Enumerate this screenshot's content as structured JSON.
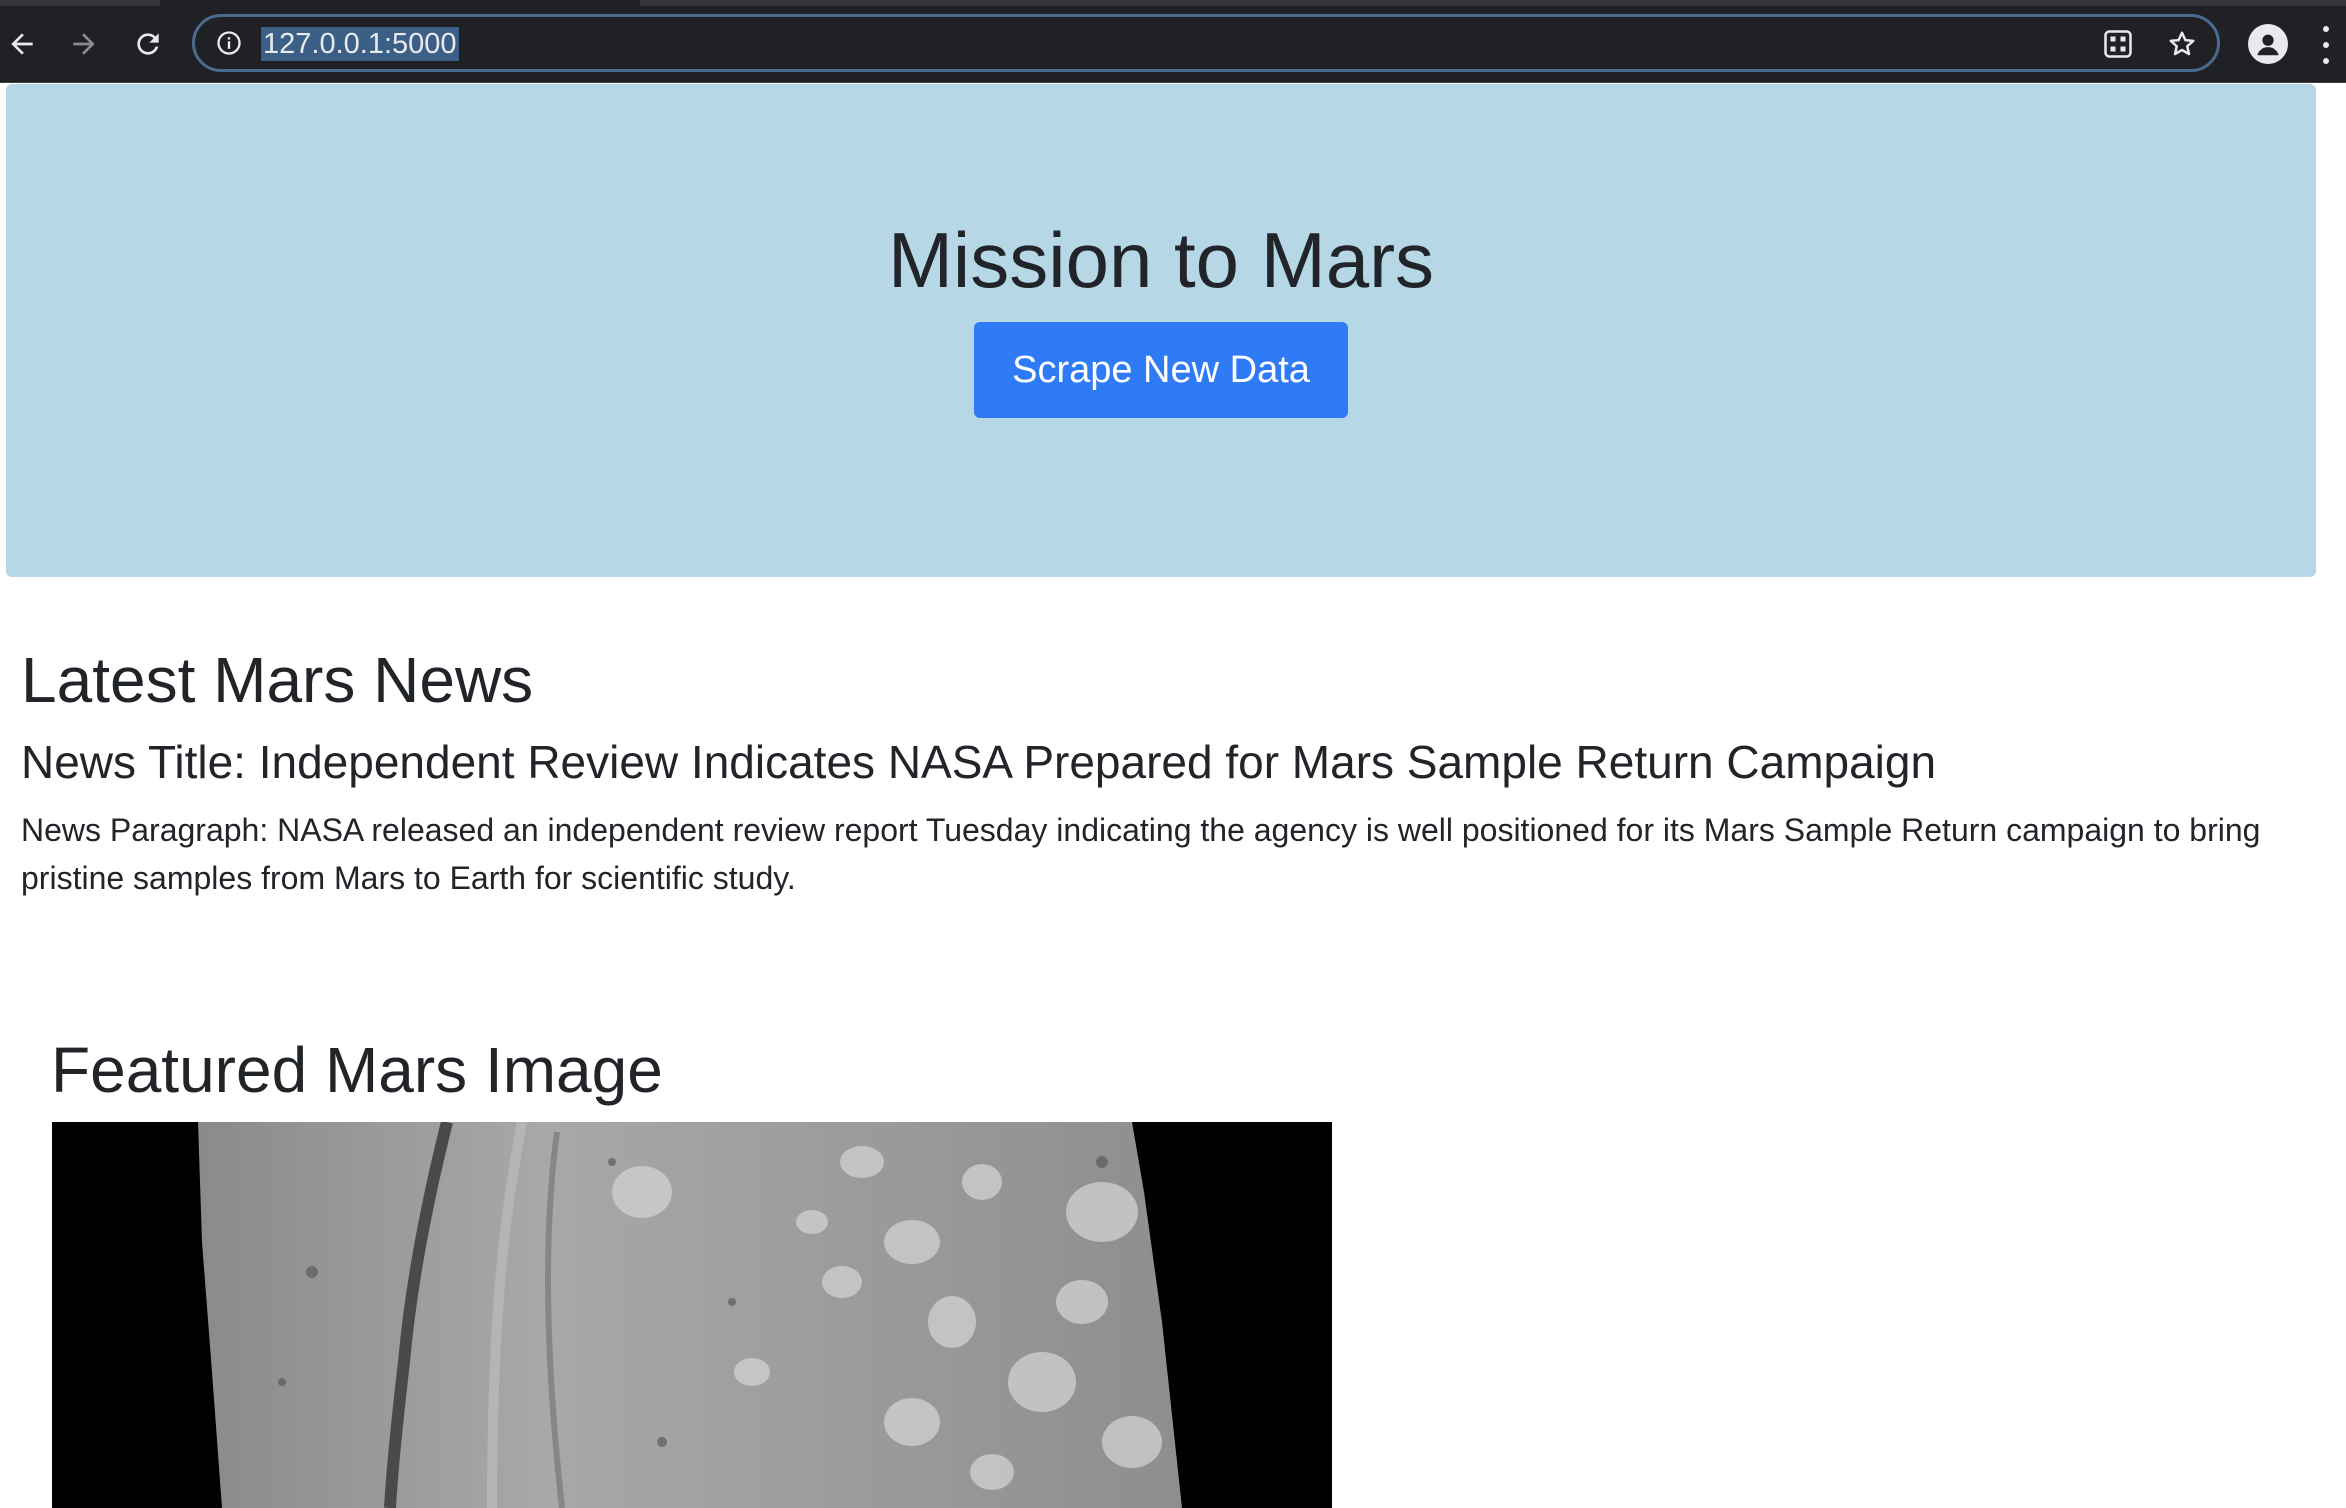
{
  "browser": {
    "url": "127.0.0.1:5000",
    "icons": [
      "back-arrow-icon",
      "forward-arrow-icon",
      "reload-icon",
      "site-info-icon",
      "qr-code-icon",
      "bookmark-star-icon",
      "profile-icon",
      "menu-dots-icon"
    ]
  },
  "hero": {
    "title": "Mission to Mars",
    "scrape_button": "Scrape New Data",
    "background_color": "#b5d7e6",
    "button_color": "#2f7bf5"
  },
  "news": {
    "heading": "Latest Mars News",
    "title": "News Title: Independent Review Indicates NASA Prepared for Mars Sample Return Campaign",
    "paragraph": "News Paragraph: NASA released an independent review report Tuesday indicating the agency is well positioned for its Mars Sample Return campaign to bring pristine samples from Mars to Earth for scientific study."
  },
  "featured": {
    "heading": "Featured Mars Image"
  }
}
